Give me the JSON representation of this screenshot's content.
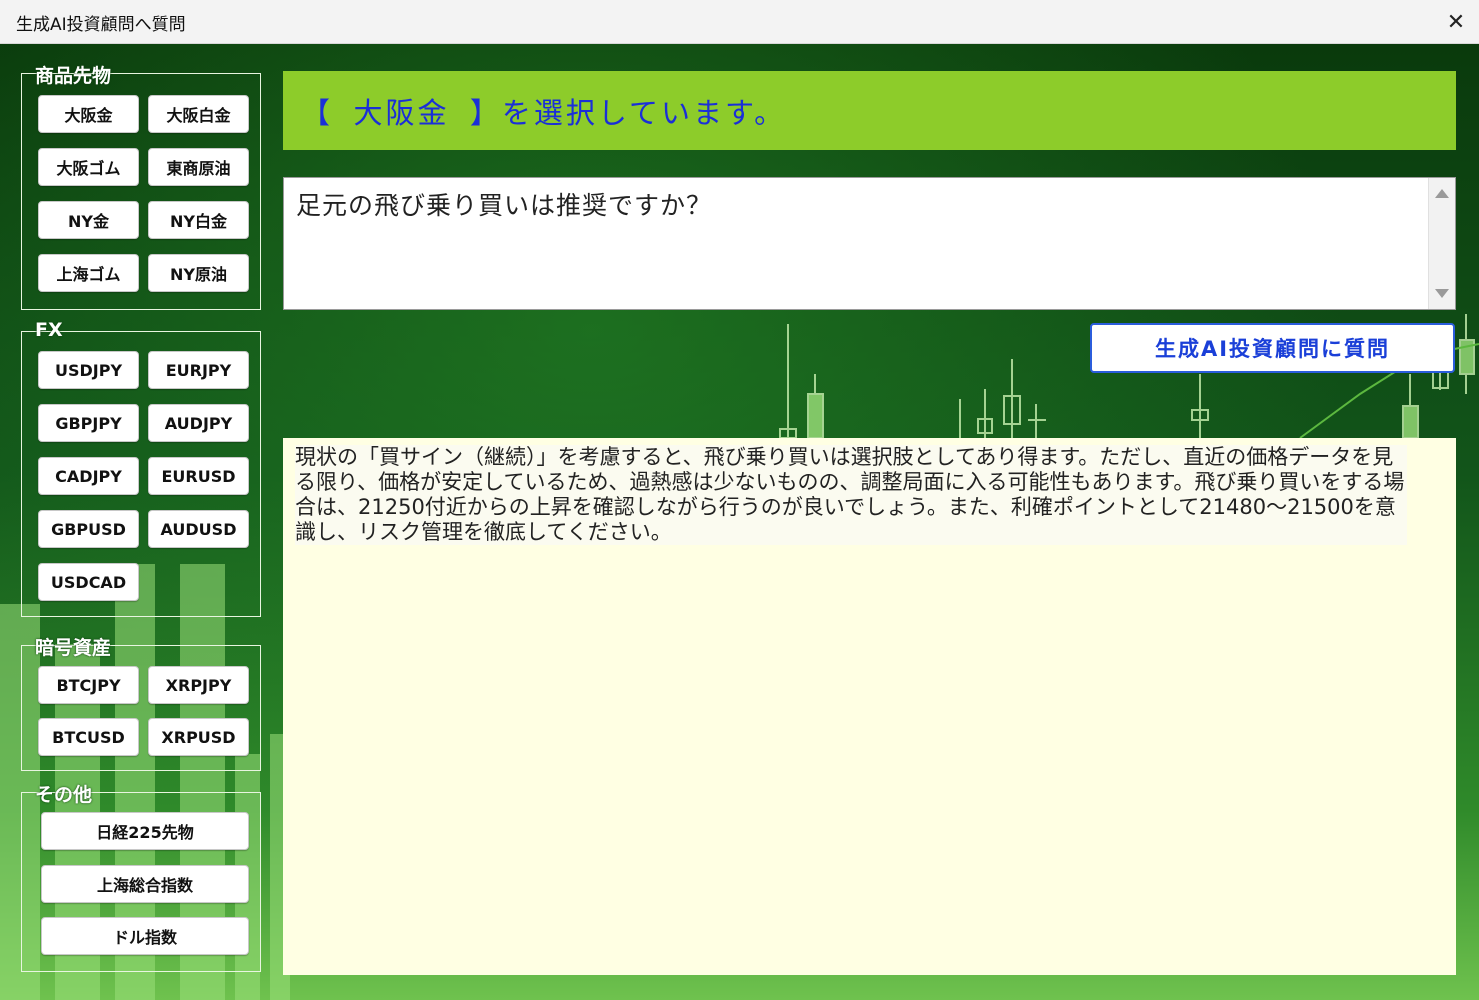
{
  "window": {
    "title": "生成AI投資顧問へ質問",
    "close_glyph": "✕"
  },
  "groups": {
    "commodities": {
      "label": "商品先物",
      "buttons": [
        "大阪金",
        "大阪白金",
        "大阪ゴム",
        "東商原油",
        "NY金",
        "NY白金",
        "上海ゴム",
        "NY原油"
      ]
    },
    "fx": {
      "label": "FX",
      "buttons": [
        "USDJPY",
        "EURJPY",
        "GBPJPY",
        "AUDJPY",
        "CADJPY",
        "EURUSD",
        "GBPUSD",
        "AUDUSD",
        "USDCAD"
      ]
    },
    "crypto": {
      "label": "暗号資産",
      "buttons": [
        "BTCJPY",
        "XRPJPY",
        "BTCUSD",
        "XRPUSD"
      ]
    },
    "other": {
      "label": "その他",
      "buttons": [
        "日経225先物",
        "上海総合指数",
        "ドル指数"
      ]
    }
  },
  "selection": {
    "text": "【 大阪金 】を選択しています。"
  },
  "question": {
    "value": "足元の飛び乗り買いは推奨ですか？"
  },
  "ask_button": {
    "label": "生成AI投資顧問に質問"
  },
  "answer": {
    "text": "現状の「買サイン（継続）」を考慮すると、飛び乗り買いは選択肢としてあり得ます。ただし、直近の価格データを見る限り、価格が安定しているため、過熱感は少ないものの、調整局面に入る可能性もあります。飛び乗り買いをする場合は、21250付近からの上昇を確認しながら行うのが良いでしょう。また、利確ポイントとして21480〜21500を意識し、リスク管理を徹底してください。"
  },
  "colors": {
    "header_bar": "#8dcc2a",
    "header_text": "#1a2fd8",
    "answer_bg": "#ffffe3",
    "ask_button_text": "#1a3fd8"
  }
}
